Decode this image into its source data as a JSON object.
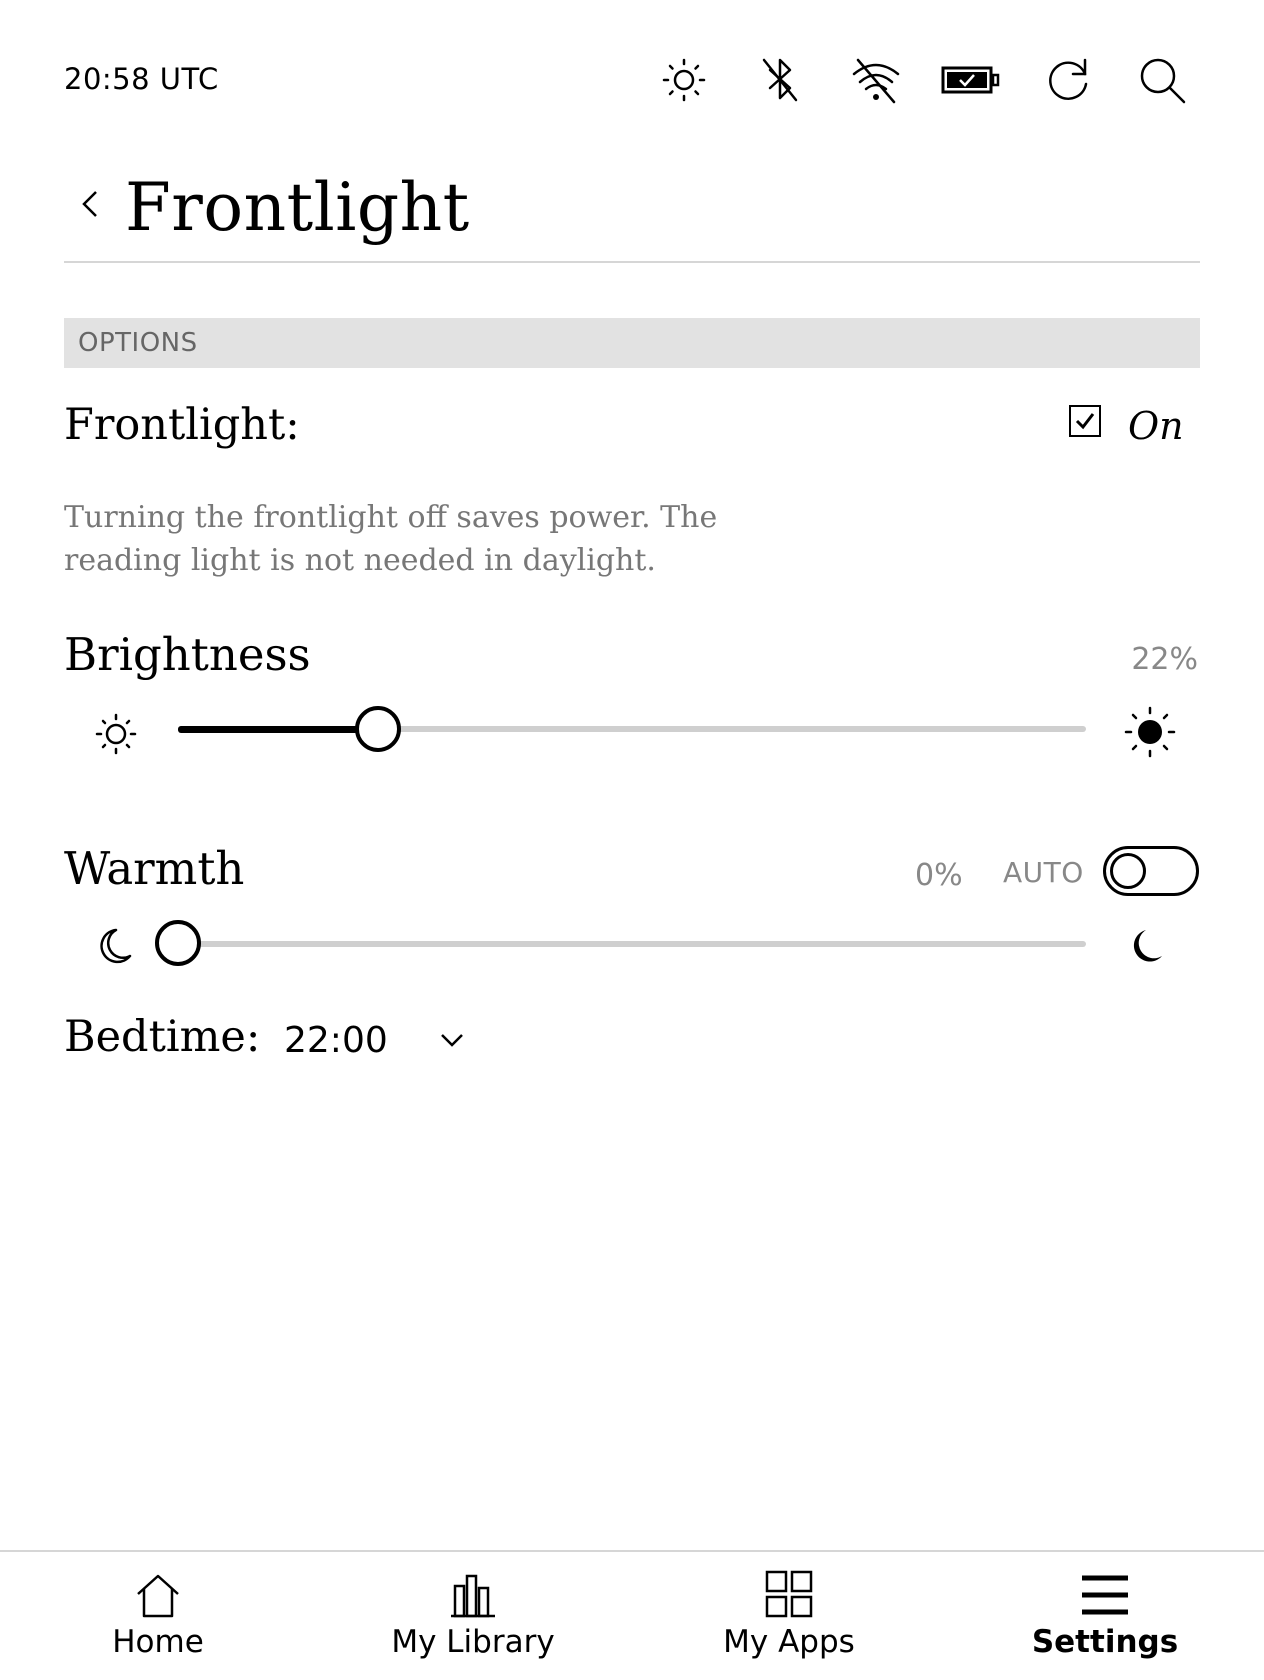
{
  "status_bar": {
    "time": "20:58 UTC",
    "icons": [
      "sun-icon",
      "bluetooth-off-icon",
      "wifi-off-icon",
      "battery-charging-icon",
      "sync-icon",
      "search-icon"
    ]
  },
  "header": {
    "title": "Frontlight"
  },
  "options": {
    "section_label": "OPTIONS",
    "frontlight_label": "Frontlight:",
    "frontlight_checked": true,
    "frontlight_state": "On",
    "description": "Turning the frontlight off saves power. The reading light is not needed in daylight."
  },
  "brightness": {
    "label": "Brightness",
    "value_text": "22%",
    "value": 22
  },
  "warmth": {
    "label": "Warmth",
    "value_text": "0%",
    "value": 0,
    "auto_label": "AUTO",
    "auto_enabled": false
  },
  "bedtime": {
    "label": "Bedtime:",
    "value": "22:00"
  },
  "nav": {
    "items": [
      {
        "label": "Home",
        "icon": "home-icon",
        "active": false
      },
      {
        "label": "My Library",
        "icon": "library-icon",
        "active": false
      },
      {
        "label": "My Apps",
        "icon": "apps-icon",
        "active": false
      },
      {
        "label": "Settings",
        "icon": "settings-icon",
        "active": true
      }
    ]
  }
}
